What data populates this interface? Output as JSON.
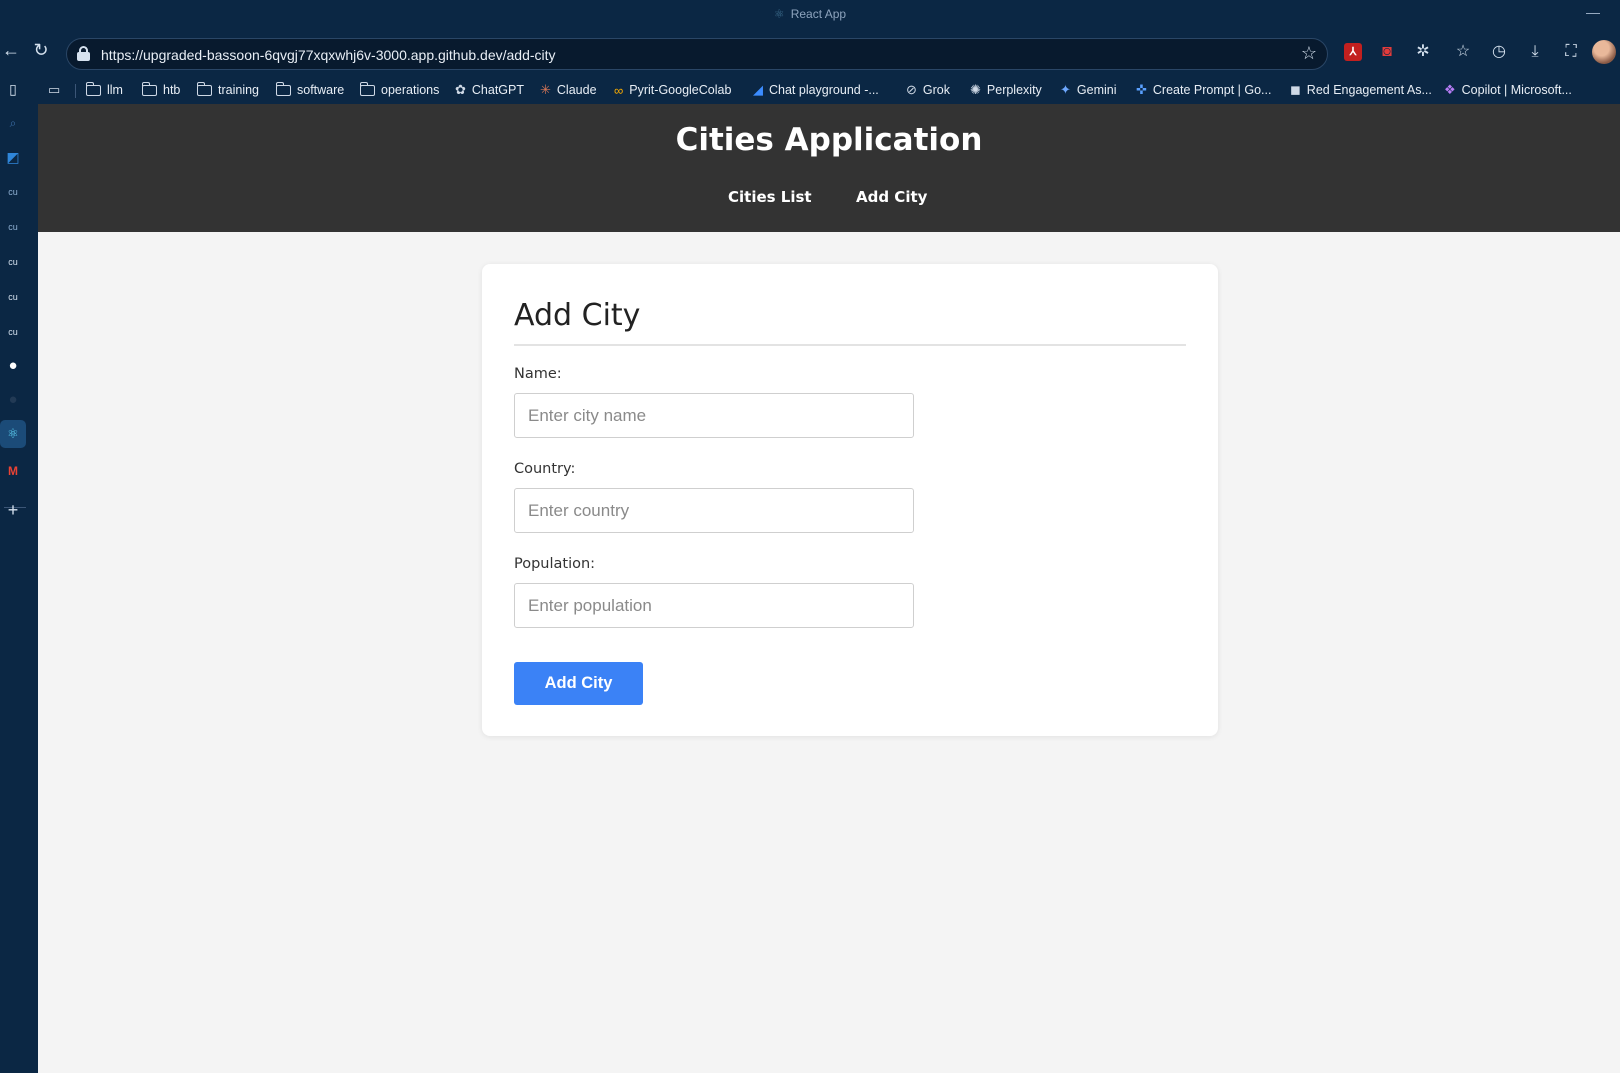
{
  "window": {
    "title": "React App",
    "title_icon": "react-icon",
    "minimize": "—"
  },
  "browser": {
    "url": "https://upgraded-bassoon-6qvgj77xqxwhj6v-3000.app.github.dev/add-city",
    "toolbar_icons": [
      "back-icon",
      "reload-icon",
      "lock-icon",
      "star-icon",
      "pdf-icon",
      "camera-icon",
      "extensions-icon",
      "favorites-icon",
      "history-icon",
      "download-icon",
      "screenshot-icon",
      "profile-avatar"
    ]
  },
  "bookmarks": [
    {
      "label": "llm",
      "icon": "folder-icon"
    },
    {
      "label": "htb",
      "icon": "folder-icon"
    },
    {
      "label": "training",
      "icon": "folder-icon"
    },
    {
      "label": "software",
      "icon": "folder-icon"
    },
    {
      "label": "operations",
      "icon": "folder-icon"
    },
    {
      "label": "ChatGPT",
      "icon": "chatgpt-icon"
    },
    {
      "label": "Claude",
      "icon": "claude-icon"
    },
    {
      "label": "Pyrit-GoogleColab",
      "icon": "colab-icon"
    },
    {
      "label": "Chat playground -...",
      "icon": "azure-icon"
    },
    {
      "label": "Grok",
      "icon": "grok-icon"
    },
    {
      "label": "Perplexity",
      "icon": "perplexity-icon"
    },
    {
      "label": "Gemini",
      "icon": "gemini-icon"
    },
    {
      "label": "Create Prompt | Go...",
      "icon": "prompt-icon"
    },
    {
      "label": "Red Engagement As...",
      "icon": "red-engagement-icon"
    },
    {
      "label": "Copilot | Microsoft...",
      "icon": "copilot-icon"
    }
  ],
  "sidebar": {
    "items": [
      "tabs-icon",
      "search-icon",
      "outlook-icon",
      "cu-icon",
      "cu-icon",
      "cu-icon",
      "cu-icon",
      "cu-icon",
      "github-icon",
      "github-icon",
      "react-icon",
      "gmail-icon",
      "add-icon"
    ],
    "cu_label": "cu"
  },
  "app": {
    "title": "Cities Application",
    "nav": {
      "cities_list": "Cities List",
      "add_city": "Add City"
    }
  },
  "form": {
    "title": "Add City",
    "fields": {
      "name": {
        "label": "Name:",
        "placeholder": "Enter city name",
        "value": ""
      },
      "country": {
        "label": "Country:",
        "placeholder": "Enter country",
        "value": ""
      },
      "population": {
        "label": "Population:",
        "placeholder": "Enter population",
        "value": ""
      }
    },
    "submit_label": "Add City"
  },
  "colors": {
    "browser_chrome": "#0b2744",
    "app_header": "#333333",
    "page_bg": "#f4f4f4",
    "button": "#3b82f6"
  }
}
